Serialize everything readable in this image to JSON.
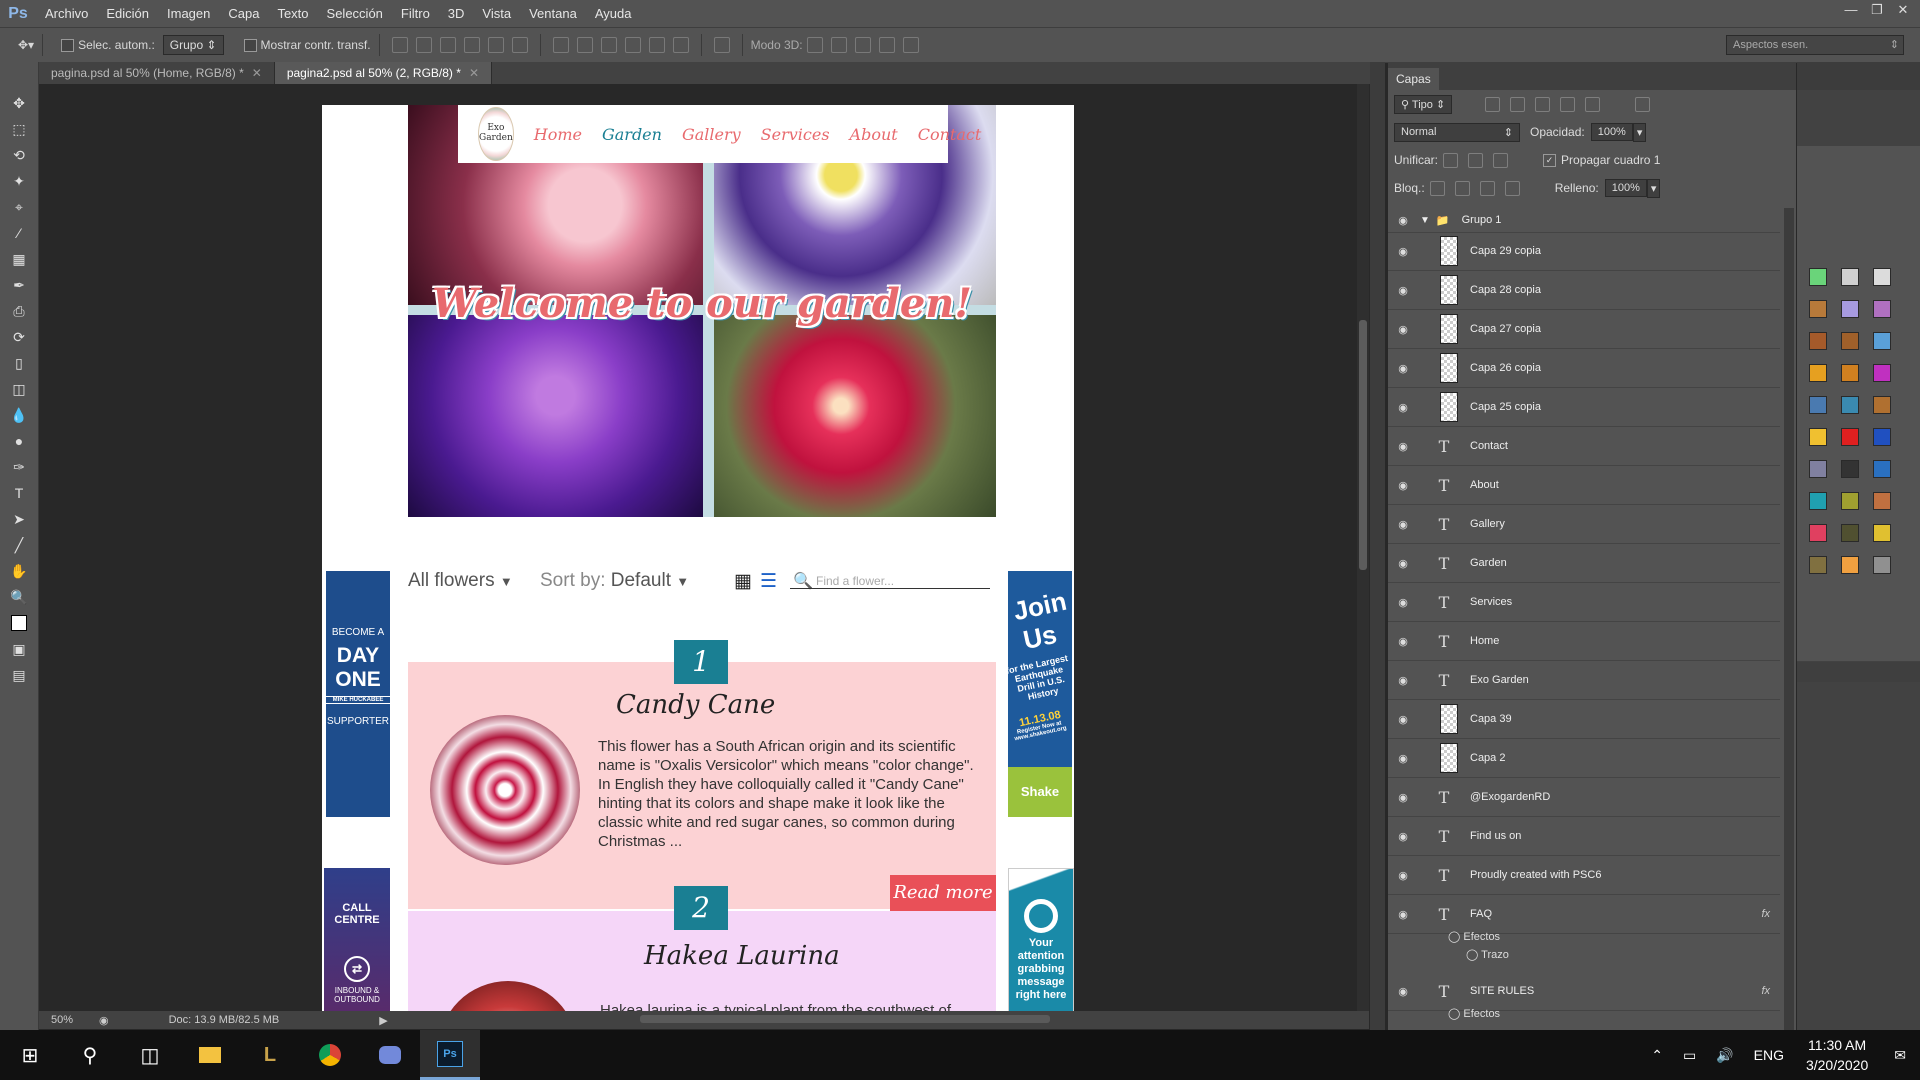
{
  "app": {
    "logo": "Ps"
  },
  "menubar": {
    "items": [
      "Archivo",
      "Edición",
      "Imagen",
      "Capa",
      "Texto",
      "Selección",
      "Filtro",
      "3D",
      "Vista",
      "Ventana",
      "Ayuda"
    ]
  },
  "options": {
    "auto_select_label": "Selec. autom.:",
    "auto_select_value": "Grupo",
    "show_transform_label": "Mostrar contr. transf.",
    "mode3d_label": "Modo 3D:",
    "workspace": "Aspectos esen."
  },
  "tabs": [
    {
      "label": "pagina.psd al 50% (Home, RGB/8) *",
      "active": false
    },
    {
      "label": "pagina2.psd al 50% (2, RGB/8) *",
      "active": true
    }
  ],
  "status": {
    "zoom": "50%",
    "doc": "Doc: 13.9 MB/82.5 MB"
  },
  "site": {
    "logo_text": "Exo Garden",
    "nav": [
      "Home",
      "Garden",
      "Gallery",
      "Services",
      "About",
      "Contact"
    ],
    "nav_colors": [
      "#e86a6e",
      "#1a7f93",
      "#e86a6e",
      "#e86a6e",
      "#e86a6e",
      "#e86a6e"
    ],
    "welcome": "Welcome to our garden!",
    "filter_label": "All flowers",
    "sort_label": "Sort by:",
    "sort_value": "Default",
    "search_placeholder": "Find a flower...",
    "banners": {
      "left_top": {
        "line1": "BECOME A",
        "line2": "DAY",
        "line3": "ONE",
        "line4": "MIKE HUCKABEE",
        "line5": "SUPPORTER"
      },
      "right_top": {
        "line1": "Join",
        "line2": "Us",
        "line3": "for the Largest Earthquake Drill in U.S. History",
        "line4": "11.13.08",
        "line5": "Register Now at www.shakeout.org",
        "line6": "Shake Out"
      },
      "left_bottom": {
        "line1": "CALL",
        "line2": "CENTRE",
        "line3": "INBOUND & OUTBOUND"
      },
      "right_bottom": {
        "line1": "Your attention grabbing message right here"
      }
    },
    "cards": [
      {
        "number": "1",
        "title": "Candy Cane",
        "description": "This flower has a South African origin and its scientific name is \"Oxalis Versicolor\" which means \"color change\". In English they have colloquially called it \"Candy Cane\" hinting that its colors and shape make it look like the classic white and red sugar canes, so common during Christmas ...",
        "read_more": "Read more"
      },
      {
        "number": "2",
        "title": "Hakea Laurina",
        "description": "Hakea laurina is a typical plant from the southwest of"
      }
    ]
  },
  "layers_panel": {
    "tab": "Capas",
    "filter_kind": "Tipo",
    "blend_mode": "Normal",
    "opacity_label": "Opacidad:",
    "opacity_value": "100%",
    "unify_label": "Unificar:",
    "propagate_label": "Propagar cuadro 1",
    "lock_label": "Bloq.:",
    "fill_label": "Relleno:",
    "fill_value": "100%",
    "group_name": "Grupo 1",
    "layers": [
      {
        "name": "Capa 29 copia",
        "type": "pixel"
      },
      {
        "name": "Capa 28 copia",
        "type": "pixel"
      },
      {
        "name": "Capa 27 copia",
        "type": "pixel"
      },
      {
        "name": "Capa 26 copia",
        "type": "pixel"
      },
      {
        "name": "Capa 25 copia",
        "type": "pixel"
      },
      {
        "name": "Contact",
        "type": "text"
      },
      {
        "name": "About",
        "type": "text"
      },
      {
        "name": "Gallery",
        "type": "text"
      },
      {
        "name": "Garden",
        "type": "text"
      },
      {
        "name": "Services",
        "type": "text"
      },
      {
        "name": "Home",
        "type": "text"
      },
      {
        "name": "Exo  Garden",
        "type": "text"
      },
      {
        "name": "Capa 39",
        "type": "pixel"
      },
      {
        "name": "Capa 2",
        "type": "pixel"
      },
      {
        "name": "@ExogardenRD",
        "type": "text"
      },
      {
        "name": "Find us on",
        "type": "text"
      },
      {
        "name": "Proudly created with PSC6",
        "type": "text"
      },
      {
        "name": "FAQ",
        "type": "text",
        "fx": "fx"
      },
      {
        "name": "SITE RULES",
        "type": "text",
        "fx": "fx"
      }
    ],
    "effects_label": "Efectos",
    "stroke_label": "Trazo"
  },
  "taskbar": {
    "lang": "ENG",
    "time": "11:30 AM",
    "date": "3/20/2020"
  }
}
